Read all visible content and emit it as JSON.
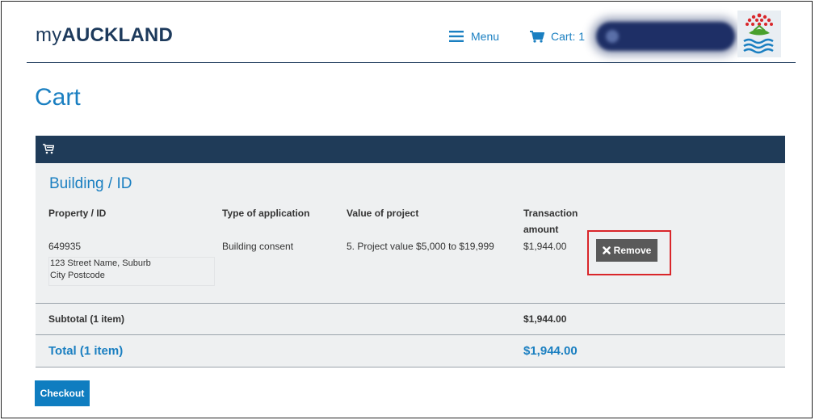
{
  "header": {
    "logo_prefix": "my",
    "logo_main": "AUCKLAND",
    "menu_label": "Menu",
    "cart_label": "Cart: 1"
  },
  "page_title": "Cart",
  "cart": {
    "section_title": "Building / ID",
    "columns": {
      "property": "Property / ID",
      "type": "Type of application",
      "value": "Value of project",
      "transaction_1": "Transaction",
      "transaction_2": "amount"
    },
    "item": {
      "property_id": "649935",
      "address_line1": "123 Street Name, Suburb",
      "address_line2": "City Postcode",
      "type": "Building consent",
      "value": "5. Project value $5,000 to $19,999",
      "amount": "$1,944.00",
      "remove_label": "Remove"
    },
    "subtotal_label": "Subtotal (1 item)",
    "subtotal_amount": "$1,944.00",
    "total_label": "Total (1 item)",
    "total_amount": "$1,944.00"
  },
  "checkout_label": "Checkout",
  "colors": {
    "accent": "#1a7fc1",
    "navy": "#1f3b58",
    "highlight": "#d9262a",
    "remove_button": "#595959"
  }
}
